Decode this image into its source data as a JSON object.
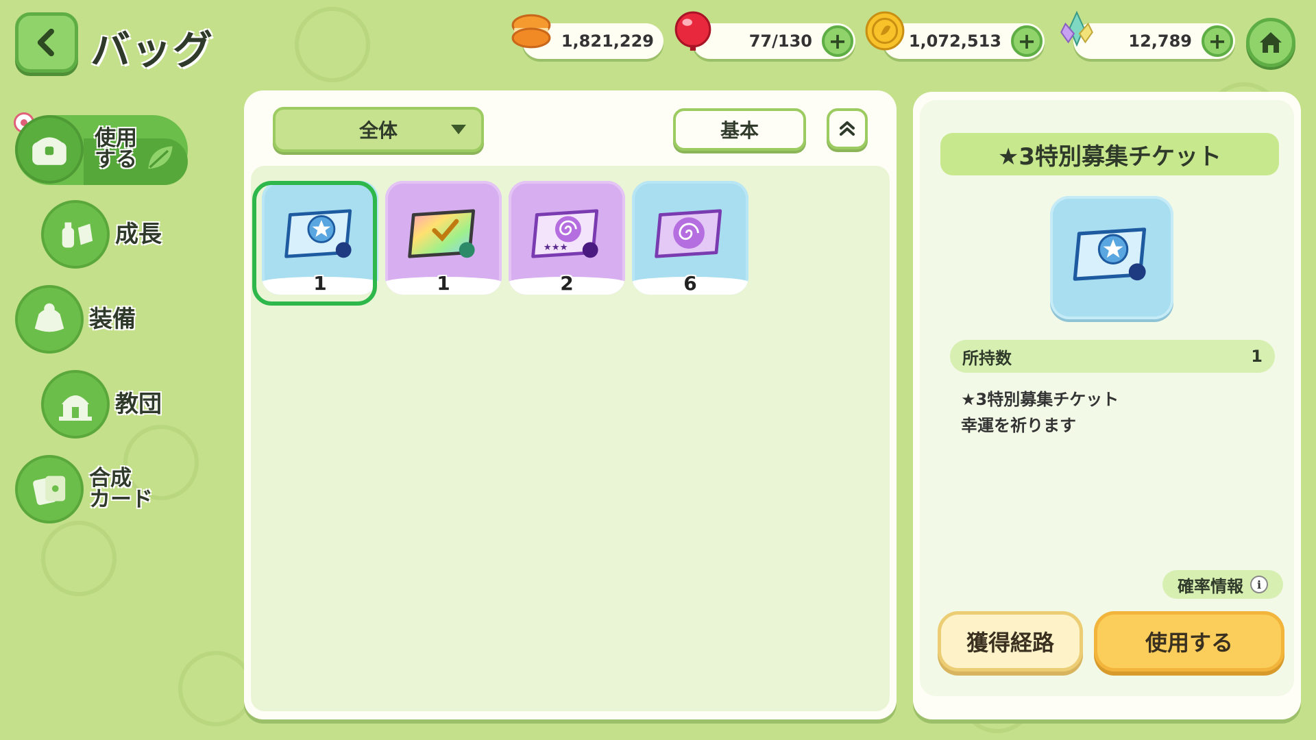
{
  "header": {
    "title": "バッグ",
    "resources": [
      {
        "name": "macaron",
        "value": "1,821,229",
        "has_plus": false
      },
      {
        "name": "stamina-candy",
        "value": "77/130",
        "has_plus": true
      },
      {
        "name": "gold-coin",
        "value": "1,072,513",
        "has_plus": true
      },
      {
        "name": "crystal",
        "value": "12,789",
        "has_plus": true
      }
    ],
    "icons": {
      "back": "back-arrow-icon",
      "home": "home-icon"
    }
  },
  "sidebar": {
    "items": [
      {
        "label_line1": "使用",
        "label_line2": "する",
        "icon": "chest-icon",
        "active": true
      },
      {
        "label": "成長",
        "icon": "potion-icon",
        "active": false
      },
      {
        "label": "装備",
        "icon": "armor-icon",
        "active": false
      },
      {
        "label": "教団",
        "icon": "temple-icon",
        "active": false
      },
      {
        "label_line1": "合成",
        "label_line2": "カード",
        "icon": "card-icon",
        "active": false
      }
    ]
  },
  "toolbar": {
    "filter_label": "全体",
    "sort_label": "基本"
  },
  "items": [
    {
      "count": "1",
      "theme": "blue",
      "icon": "star-ticket-icon",
      "selected": true
    },
    {
      "count": "1",
      "theme": "purple",
      "icon": "rainbow-ticket-icon",
      "selected": false
    },
    {
      "count": "2",
      "theme": "purple",
      "icon": "spiral-star-ticket-icon",
      "selected": false
    },
    {
      "count": "6",
      "theme": "blue",
      "icon": "spiral-ticket-icon",
      "selected": false
    }
  ],
  "detail": {
    "title": "★3特別募集チケット",
    "owned_label": "所持数",
    "owned_value": "1",
    "desc_line1": "★3特別募集チケット",
    "desc_line2": "幸運を祈ります",
    "prob_label": "確率情報",
    "info_glyph": "i",
    "route_button": "獲得経路",
    "use_button": "使用する"
  },
  "colors": {
    "background": "#c4e08a",
    "accent_green": "#6cbe4a",
    "selection": "#2eb84c",
    "use_button": "#fbcd5a"
  }
}
